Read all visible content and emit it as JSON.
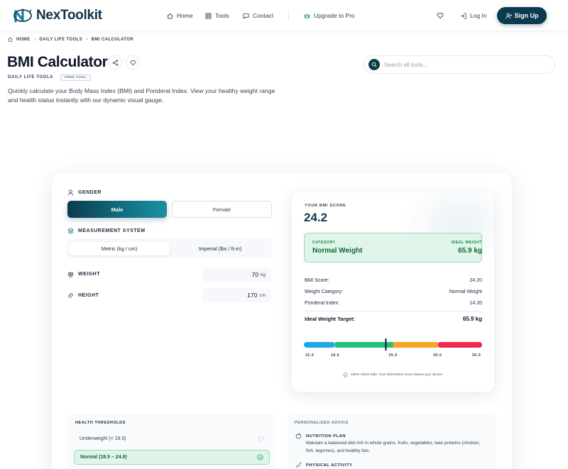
{
  "brand": {
    "name": "NexToolkit"
  },
  "nav": {
    "home": "Home",
    "tools": "Tools",
    "contact": "Contact",
    "upgrade": "Upgrade to Pro",
    "login": "Log In",
    "signup": "Sign Up"
  },
  "breadcrumb": [
    "HOME",
    "DAILY LIFE TOOLS",
    "BMI CALCULATOR"
  ],
  "page": {
    "title": "BMI Calculator",
    "category": "DAILY LIFE TOOLS",
    "badge": "FREE TOOL",
    "description": "Quickly calculate your Body Mass Index (BMI) and Ponderal Index. View your healthy weight range and health status instantly with our dynamic visual gauge."
  },
  "search": {
    "placeholder": "Search all tools..."
  },
  "form": {
    "gender_label": "GENDER",
    "gender_options": [
      "Male",
      "Female"
    ],
    "gender_selected": "Male",
    "system_label": "MEASUREMENT SYSTEM",
    "system_options": [
      "Metric (kg / cm)",
      "Imperial (lbs / ft-in)"
    ],
    "system_selected": "Metric (kg / cm)",
    "weight_label": "WEIGHT",
    "weight_value": "70",
    "weight_unit": "kg",
    "height_label": "HEIGHT",
    "height_value": "170",
    "height_unit": "cm"
  },
  "result": {
    "score_label": "YOUR BMI SCORE",
    "score": "24.2",
    "category_label": "CATEGORY",
    "category": "Normal Weight",
    "ideal_label": "IDEAL WEIGHT",
    "ideal": "65.9 kg",
    "rows": [
      {
        "label": "BMI Score:",
        "value": "24.20"
      },
      {
        "label": "Weight Category:",
        "value": "Normal Weight"
      },
      {
        "label": "Ponderal Index:",
        "value": "14.20"
      }
    ],
    "ideal_target_label": "Ideal Weight Target:",
    "ideal_target_value": "65.9 kg",
    "gauge": {
      "min": 15,
      "max": 35,
      "marker": 24.2,
      "ticks": [
        "15.0",
        "18.5",
        "25.0",
        "30.0",
        "35.0"
      ],
      "tick_values": [
        15,
        18.5,
        25,
        30,
        35
      ],
      "segments": [
        {
          "from": 15,
          "to": 18.5,
          "color": "#1fa7e6"
        },
        {
          "from": 18.5,
          "to": 25,
          "color": "#22c07a"
        },
        {
          "from": 25,
          "to": 30,
          "color": "#f5a524"
        },
        {
          "from": 30,
          "to": 35,
          "color": "#f0284d"
        }
      ]
    },
    "privacy_note": "100% Client-Side. Your information never leaves your device."
  },
  "thresholds": {
    "title": "HEALTH THRESHOLDS",
    "items": [
      {
        "label": "Underweight (< 18.5)"
      },
      {
        "label": "Normal (18.5 – 24.9)"
      }
    ]
  },
  "advice": {
    "title": "PERSONALIZED ADVICE",
    "nutrition_title": "NUTRITION PLAN",
    "nutrition_text": "Maintain a balanced diet rich in whole grains, fruits, vegetables, lean proteins (chicken, fish, legumes), and healthy fats.",
    "activity_title": "PHYSICAL ACTIVITY"
  },
  "colors": {
    "brand_dark": "#0c3a4e",
    "accent_teal": "#147a8e",
    "success_bg": "#dff5e9",
    "success_text": "#166534"
  }
}
